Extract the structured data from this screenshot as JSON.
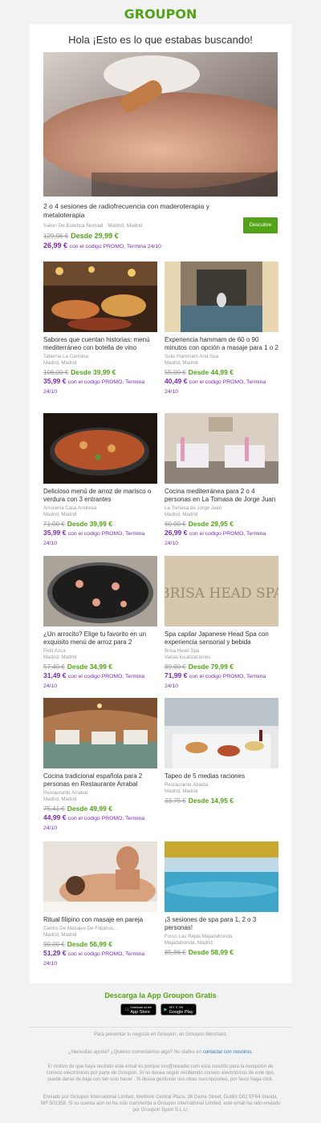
{
  "brand": {
    "logo_text": "GROUPON",
    "accent": "#53a318",
    "promo_color": "#7a2ab0"
  },
  "heading": "Hola ¡Esto es lo que estabas buscando!",
  "hero": {
    "title": "2 o 4 sesiones de radiofrecuencia con maderoterapia y metaloterapia",
    "merchant": "Salon De Estetica Nomad",
    "location": "Madrid, Madrid",
    "old_price": "129,96 €",
    "price": "Desde 29,99 €",
    "promo_price": "26,99 €",
    "promo_text": "con el codigo PROMO, Termina 24/10",
    "button": "Descubre"
  },
  "deals": [
    {
      "title": "Sabores que cuentan historias: menú mediterráneo con botella de vino",
      "merchant": "Taberna La Carmela",
      "location": "Madrid, Madrid",
      "old_price": "106,00 €",
      "price": "Desde 39,99 €",
      "promo_price": "35,99 €",
      "promo_text": "con el codigo PROMO, Termina 24/10",
      "image": "restaurant-food-photo"
    },
    {
      "title": "Experiencia hammam de 60 o 90 minutos con opción a masaje para 1 o 2",
      "merchant": "Sulis Hammam And Spa",
      "location": "Madrid, Madrid",
      "old_price": "55,00 €",
      "price": "Desde 44,99 €",
      "promo_price": "40,49 €",
      "promo_text": "con el codigo PROMO, Termina 24/10",
      "image": "hammam-pool-photo"
    },
    {
      "title": "Delicioso menú de arroz de marisco o verdura con 3 entrantes",
      "merchant": "Arrocería Casa Andreea",
      "location": "Madrid, Madrid",
      "old_price": "71,00 €",
      "price": "Desde 39,99 €",
      "promo_price": "35,99 €",
      "promo_text": "con el codigo PROMO, Termina 24/10",
      "image": "paella-photo"
    },
    {
      "title": "Cocina mediterránea para 2 o 4 personas en La Tomasa de Jorge Juan",
      "merchant": "La Tomasa de Jorge Juan",
      "location": "Madrid, Madrid",
      "old_price": "60,00 €",
      "price": "Desde 29,95 €",
      "promo_price": "26,99 €",
      "promo_text": "con el codigo PROMO, Termina 24/10",
      "image": "dining-room-photo"
    },
    {
      "title": "¿Un arrocito? Elige tu favorito en un exquisito menú de arroz para 2",
      "merchant": "Petit Azca",
      "location": "Madrid, Madrid",
      "old_price": "57,40 €",
      "price": "Desde 34,99 €",
      "promo_price": "31,49 €",
      "promo_text": "con el codigo PROMO, Termina 24/10",
      "image": "black-rice-photo"
    },
    {
      "title": "Spa capilar Japanese Head Spa con experiencia sensorial y bebida",
      "merchant": "Brisa Head Spa",
      "location": "Varias localizaciones",
      "old_price": "89,00 €",
      "price": "Desde 79,99 €",
      "promo_price": "71,99 €",
      "promo_text": "con el codigo PROMO, Termina 24/10",
      "image": "head-spa-sign-photo",
      "sign_text": "BRISA HEAD SPA"
    },
    {
      "title": "Cocina tradicional española para 2 personas en Restaurante Arrabal",
      "merchant": "Restaurante Arrabal",
      "location": "Madrid, Madrid",
      "old_price": "75,41 €",
      "price": "Desde 49,99 €",
      "promo_price": "44,99 €",
      "promo_text": "con el codigo PROMO, Termina 24/10",
      "image": "restaurant-interior-photo"
    },
    {
      "title": "Tapeo de 5 medias raciones",
      "merchant": "Restaurante Abadia",
      "location": "Madrid, Madrid",
      "old_price": "33,75 €",
      "price": "Desde 14,95 €",
      "promo_price": "",
      "promo_text": "",
      "image": "tapas-terrace-photo"
    },
    {
      "title": "Ritual filipino con masaje en pareja",
      "merchant": "Centro De Masajes De Filipinos...",
      "location": "Madrid, Madrid",
      "old_price": "90,00 €",
      "price": "Desde 56,99 €",
      "promo_price": "51,29 €",
      "promo_text": "con el codigo PROMO, Termina 24/10",
      "image": "massage-photo"
    },
    {
      "title": "¡3 sesiones de spa para 1, 2 o 3 personas!",
      "merchant": "Forus Las Rejas Majadahonda",
      "location": "Majadahonda, Madrid",
      "old_price": "85,86 €",
      "price": "Desde 58,99 €",
      "promo_price": "",
      "promo_text": "",
      "image": "indoor-pool-photo"
    }
  ],
  "footer": {
    "download": "Descarga la App Groupon Gratis",
    "appstore_small": "Download on the",
    "appstore": "App Store",
    "googleplay_small": "GET IT ON",
    "googleplay": "Google Play",
    "merchant_line": "Para presentar tu negocio en Groupon, en Groupon Merchant.",
    "help_text": "¿Necesitas ayuda? ¿Quieres comentarnos algo? No dudes en",
    "help_link": "contactar con nosotros.",
    "reason": "El motivo de que haya recibido este email es porque xxx@ureader.com está suscrito para la recepción de correos electrónicos por parte de Groupon. Si no desea seguir recibiendo correos electrónicos de este tipo, puede darse de baja con tan solo hacer . Si desea gestionar sus otras suscripciones, por favor haga click.",
    "sender": "Enviado por Groupon International Limited, WeWork Central Plaza, 36 Dame Street, Dublin D02 EF64 Irlanda, NIF:501358. Si su cuenta aún no ha sido transferida a Groupon International Limited, este email ha sido enviado por Groupon Spain S.L.U."
  }
}
